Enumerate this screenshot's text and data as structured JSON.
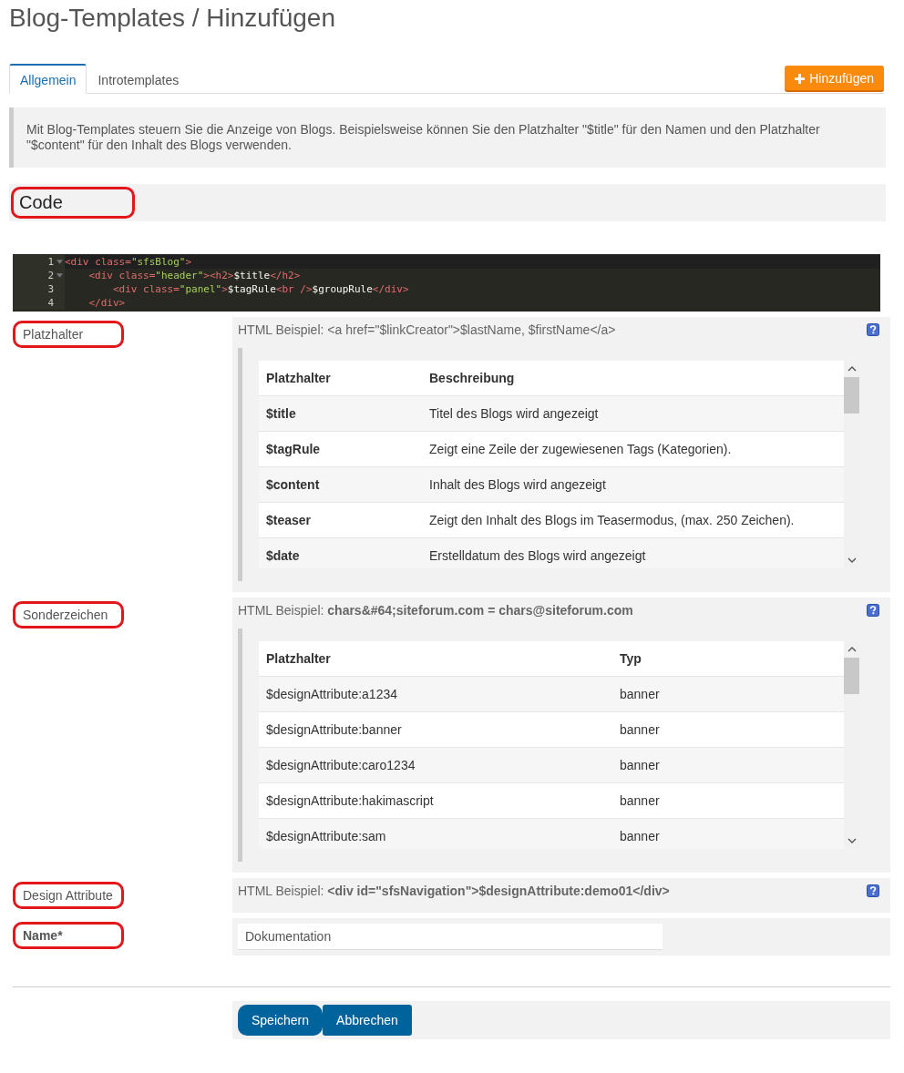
{
  "page_title": "Blog-Templates / Hinzufügen",
  "tabs": [
    {
      "label": "Allgemein",
      "selected": true
    },
    {
      "label": "Introtemplates",
      "selected": false
    }
  ],
  "add_button": {
    "label": "Hinzufügen"
  },
  "info": "Mit Blog-Templates steuern Sie die Anzeige von Blogs. Beispielsweise können Sie den Platzhalter \"$title\" für den Namen und den Platzhalter \"$content\" für den Inhalt des Blogs verwenden.",
  "code_section": {
    "title": "Code",
    "highlighted": true
  },
  "code_lines": [
    {
      "number": "1",
      "foldable": true,
      "tokens": [
        {
          "kind": "tag",
          "text": "<div "
        },
        {
          "kind": "attr",
          "text": "class="
        },
        {
          "kind": "string",
          "text": "\"sfsBlog\""
        },
        {
          "kind": "tag",
          "text": ">"
        }
      ]
    },
    {
      "number": "2",
      "foldable": true,
      "tokens": [
        {
          "kind": "tag",
          "text": "    <div "
        },
        {
          "kind": "attr",
          "text": "class="
        },
        {
          "kind": "string",
          "text": "\"header\""
        },
        {
          "kind": "tag",
          "text": "><h2>"
        },
        {
          "kind": "text",
          "text": "$title"
        },
        {
          "kind": "tag",
          "text": "</h2>"
        }
      ]
    },
    {
      "number": "3",
      "foldable": false,
      "tokens": [
        {
          "kind": "tag",
          "text": "        <div "
        },
        {
          "kind": "attr",
          "text": "class="
        },
        {
          "kind": "string",
          "text": "\"panel\""
        },
        {
          "kind": "tag",
          "text": ">"
        },
        {
          "kind": "text",
          "text": "$tagRule"
        },
        {
          "kind": "tag",
          "text": "<br />"
        },
        {
          "kind": "text",
          "text": "$groupRule"
        },
        {
          "kind": "tag",
          "text": "</div>"
        }
      ]
    },
    {
      "number": "4",
      "foldable": false,
      "tokens": [
        {
          "kind": "tag",
          "text": "    </div>"
        }
      ]
    }
  ],
  "fields": [
    {
      "kind": "table",
      "label": "Platzhalter",
      "highlighted": true,
      "hint": "HTML Beispiel: <a href=\"$linkCreator\">$lastName, $firstName</a>",
      "bold_first_column": true,
      "columns": [
        "Platzhalter",
        "Beschreibung"
      ],
      "rows": [
        [
          "$title",
          "Titel des Blogs wird angezeigt"
        ],
        [
          "$tagRule",
          "Zeigt eine Zeile der zugewiesenen Tags (Kategorien)."
        ],
        [
          "$content",
          "Inhalt des Blogs wird angezeigt"
        ],
        [
          "$teaser",
          "Zeigt den Inhalt des Blogs im Teasermodus, (max. 250 Zeichen)."
        ],
        [
          "$date",
          "Erstelldatum des Blogs wird angezeigt"
        ]
      ]
    },
    {
      "kind": "table",
      "label": "Sonderzeichen",
      "highlighted": true,
      "hint": "HTML Beispiel: **chars&#64;siteforum.com = chars@siteforum.com**",
      "bold_first_column": false,
      "columns": [
        "Platzhalter",
        "Typ"
      ],
      "rows": [
        [
          "$designAttribute:a1234",
          "banner"
        ],
        [
          "$designAttribute:banner",
          "banner"
        ],
        [
          "$designAttribute:caro1234",
          "banner"
        ],
        [
          "$designAttribute:hakimascript",
          "banner"
        ],
        [
          "$designAttribute:sam",
          "banner"
        ]
      ]
    },
    {
      "kind": "hint",
      "label": "Design Attribute",
      "highlighted": true,
      "hint": "HTML Beispiel: **<div id=\"sfsNavigation\">$designAttribute:demo01</div>**"
    },
    {
      "kind": "input",
      "label": "Name*",
      "highlighted": true,
      "value": "Dokumentation"
    }
  ],
  "buttons": [
    {
      "label": "Speichern",
      "highlighted": true
    },
    {
      "label": "Abbrechen",
      "highlighted": false
    }
  ]
}
